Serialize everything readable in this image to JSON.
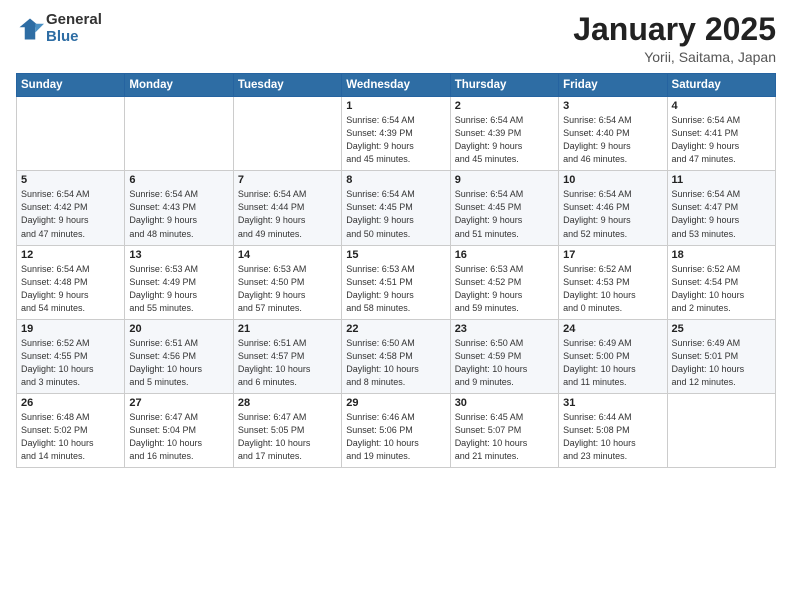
{
  "logo": {
    "general": "General",
    "blue": "Blue"
  },
  "title": "January 2025",
  "location": "Yorii, Saitama, Japan",
  "weekdays": [
    "Sunday",
    "Monday",
    "Tuesday",
    "Wednesday",
    "Thursday",
    "Friday",
    "Saturday"
  ],
  "weeks": [
    [
      {
        "day": "",
        "info": ""
      },
      {
        "day": "",
        "info": ""
      },
      {
        "day": "",
        "info": ""
      },
      {
        "day": "1",
        "info": "Sunrise: 6:54 AM\nSunset: 4:39 PM\nDaylight: 9 hours\nand 45 minutes."
      },
      {
        "day": "2",
        "info": "Sunrise: 6:54 AM\nSunset: 4:39 PM\nDaylight: 9 hours\nand 45 minutes."
      },
      {
        "day": "3",
        "info": "Sunrise: 6:54 AM\nSunset: 4:40 PM\nDaylight: 9 hours\nand 46 minutes."
      },
      {
        "day": "4",
        "info": "Sunrise: 6:54 AM\nSunset: 4:41 PM\nDaylight: 9 hours\nand 47 minutes."
      }
    ],
    [
      {
        "day": "5",
        "info": "Sunrise: 6:54 AM\nSunset: 4:42 PM\nDaylight: 9 hours\nand 47 minutes."
      },
      {
        "day": "6",
        "info": "Sunrise: 6:54 AM\nSunset: 4:43 PM\nDaylight: 9 hours\nand 48 minutes."
      },
      {
        "day": "7",
        "info": "Sunrise: 6:54 AM\nSunset: 4:44 PM\nDaylight: 9 hours\nand 49 minutes."
      },
      {
        "day": "8",
        "info": "Sunrise: 6:54 AM\nSunset: 4:45 PM\nDaylight: 9 hours\nand 50 minutes."
      },
      {
        "day": "9",
        "info": "Sunrise: 6:54 AM\nSunset: 4:45 PM\nDaylight: 9 hours\nand 51 minutes."
      },
      {
        "day": "10",
        "info": "Sunrise: 6:54 AM\nSunset: 4:46 PM\nDaylight: 9 hours\nand 52 minutes."
      },
      {
        "day": "11",
        "info": "Sunrise: 6:54 AM\nSunset: 4:47 PM\nDaylight: 9 hours\nand 53 minutes."
      }
    ],
    [
      {
        "day": "12",
        "info": "Sunrise: 6:54 AM\nSunset: 4:48 PM\nDaylight: 9 hours\nand 54 minutes."
      },
      {
        "day": "13",
        "info": "Sunrise: 6:53 AM\nSunset: 4:49 PM\nDaylight: 9 hours\nand 55 minutes."
      },
      {
        "day": "14",
        "info": "Sunrise: 6:53 AM\nSunset: 4:50 PM\nDaylight: 9 hours\nand 57 minutes."
      },
      {
        "day": "15",
        "info": "Sunrise: 6:53 AM\nSunset: 4:51 PM\nDaylight: 9 hours\nand 58 minutes."
      },
      {
        "day": "16",
        "info": "Sunrise: 6:53 AM\nSunset: 4:52 PM\nDaylight: 9 hours\nand 59 minutes."
      },
      {
        "day": "17",
        "info": "Sunrise: 6:52 AM\nSunset: 4:53 PM\nDaylight: 10 hours\nand 0 minutes."
      },
      {
        "day": "18",
        "info": "Sunrise: 6:52 AM\nSunset: 4:54 PM\nDaylight: 10 hours\nand 2 minutes."
      }
    ],
    [
      {
        "day": "19",
        "info": "Sunrise: 6:52 AM\nSunset: 4:55 PM\nDaylight: 10 hours\nand 3 minutes."
      },
      {
        "day": "20",
        "info": "Sunrise: 6:51 AM\nSunset: 4:56 PM\nDaylight: 10 hours\nand 5 minutes."
      },
      {
        "day": "21",
        "info": "Sunrise: 6:51 AM\nSunset: 4:57 PM\nDaylight: 10 hours\nand 6 minutes."
      },
      {
        "day": "22",
        "info": "Sunrise: 6:50 AM\nSunset: 4:58 PM\nDaylight: 10 hours\nand 8 minutes."
      },
      {
        "day": "23",
        "info": "Sunrise: 6:50 AM\nSunset: 4:59 PM\nDaylight: 10 hours\nand 9 minutes."
      },
      {
        "day": "24",
        "info": "Sunrise: 6:49 AM\nSunset: 5:00 PM\nDaylight: 10 hours\nand 11 minutes."
      },
      {
        "day": "25",
        "info": "Sunrise: 6:49 AM\nSunset: 5:01 PM\nDaylight: 10 hours\nand 12 minutes."
      }
    ],
    [
      {
        "day": "26",
        "info": "Sunrise: 6:48 AM\nSunset: 5:02 PM\nDaylight: 10 hours\nand 14 minutes."
      },
      {
        "day": "27",
        "info": "Sunrise: 6:47 AM\nSunset: 5:04 PM\nDaylight: 10 hours\nand 16 minutes."
      },
      {
        "day": "28",
        "info": "Sunrise: 6:47 AM\nSunset: 5:05 PM\nDaylight: 10 hours\nand 17 minutes."
      },
      {
        "day": "29",
        "info": "Sunrise: 6:46 AM\nSunset: 5:06 PM\nDaylight: 10 hours\nand 19 minutes."
      },
      {
        "day": "30",
        "info": "Sunrise: 6:45 AM\nSunset: 5:07 PM\nDaylight: 10 hours\nand 21 minutes."
      },
      {
        "day": "31",
        "info": "Sunrise: 6:44 AM\nSunset: 5:08 PM\nDaylight: 10 hours\nand 23 minutes."
      },
      {
        "day": "",
        "info": ""
      }
    ]
  ]
}
